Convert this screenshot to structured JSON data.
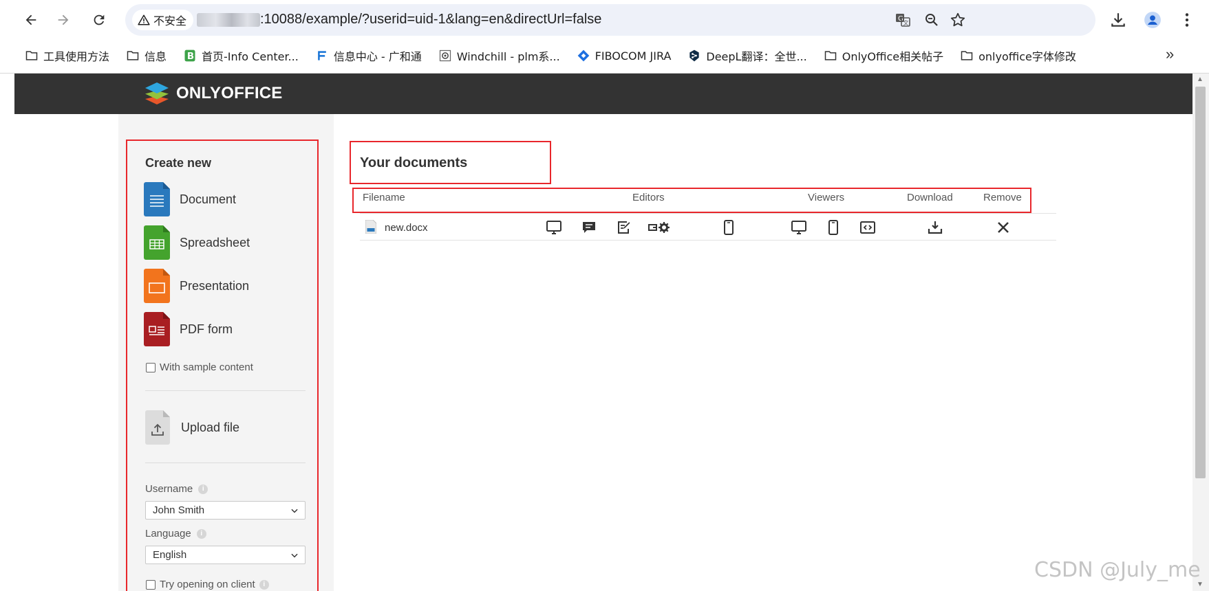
{
  "browser": {
    "security_label": "不安全",
    "url": ":10088/example/?userid=uid-1&lang=en&directUrl=false",
    "bookmarks": [
      {
        "label": "工具使用方法",
        "icon": "folder-icon"
      },
      {
        "label": "信息",
        "icon": "folder-icon"
      },
      {
        "label": "首页-Info Center...",
        "icon": "b-logo-icon"
      },
      {
        "label": "信息中心 - 广和通",
        "icon": "f-logo-icon"
      },
      {
        "label": "Windchill - plm系...",
        "icon": "windchill-icon"
      },
      {
        "label": "FIBOCOM JIRA",
        "icon": "jira-icon"
      },
      {
        "label": "DeepL翻译：全世...",
        "icon": "deepl-icon"
      },
      {
        "label": "OnlyOffice相关帖子",
        "icon": "folder-icon"
      },
      {
        "label": "onlyoffice字体修改",
        "icon": "folder-icon"
      }
    ],
    "more_label": "»"
  },
  "header": {
    "logo_text": "ONLYOFFICE"
  },
  "sidebar": {
    "create_title": "Create new",
    "create_items": [
      {
        "label": "Document",
        "color": "#2a79bd"
      },
      {
        "label": "Spreadsheet",
        "color": "#44a32d"
      },
      {
        "label": "Presentation",
        "color": "#f2741d"
      },
      {
        "label": "PDF form",
        "color": "#a91e22"
      }
    ],
    "sample_label": "With sample content",
    "upload_label": "Upload file",
    "username_label": "Username",
    "username_value": "John Smith",
    "language_label": "Language",
    "language_value": "English",
    "client_label": "Try opening on client"
  },
  "documents": {
    "title": "Your documents",
    "columns": {
      "filename": "Filename",
      "editors": "Editors",
      "viewers": "Viewers",
      "download": "Download",
      "remove": "Remove"
    },
    "rows": [
      {
        "filename": "new.docx"
      }
    ]
  },
  "watermark": "CSDN @July_me",
  "colors": {
    "header": "#333333",
    "highlight": "#e8262b",
    "sidebar": "#f4f4f4"
  }
}
